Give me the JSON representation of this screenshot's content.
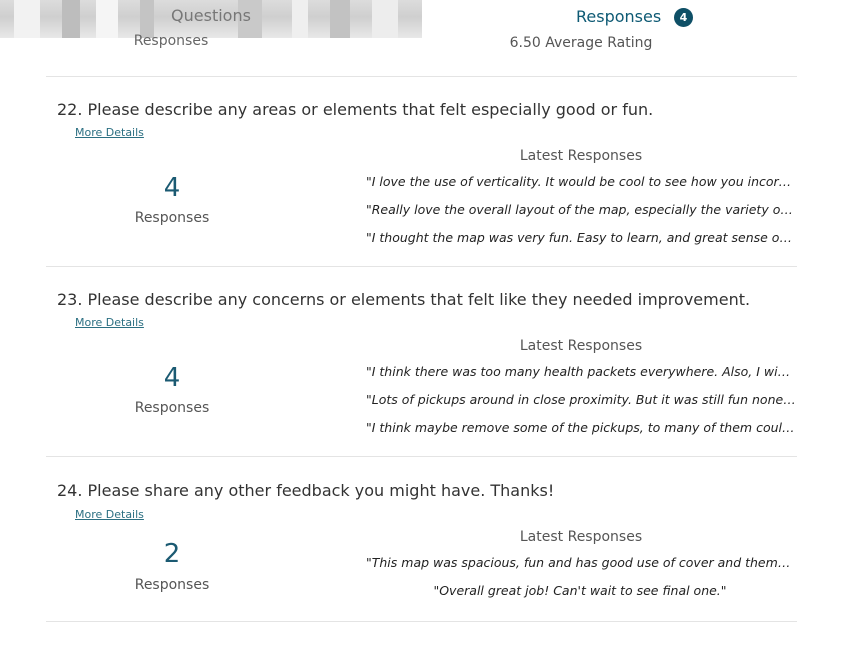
{
  "tabs": {
    "questions_label": "Questions",
    "questions_sub": "Responses",
    "responses_label": "Responses",
    "responses_badge": "4"
  },
  "previous": {
    "average_rating": "6.50 Average Rating"
  },
  "questions": [
    {
      "title": "22.  Please describe any areas or elements that felt especially good or fun.",
      "more_details": "More Details",
      "count": "4",
      "count_label": "Responses",
      "latest_title": "Latest Responses",
      "responses": [
        "\"I love the use of verticality. It would be cool to see how you incorporate more of it in your final map.\"",
        "\"Really love the overall layout of the map, especially the variety of the routes you can take.\"",
        "\"I thought the map was very fun. Easy to learn, and great sense of space throughout.\""
      ]
    },
    {
      "title": "23.  Please describe any concerns or elements that felt like they needed improvement.",
      "more_details": "More Details",
      "count": "4",
      "count_label": "Responses",
      "latest_title": "Latest Responses",
      "responses": [
        "\"I think there was too many health packets everywhere. Also, I wished there were more cover.\"",
        "\"Lots of pickups around in close proximity. But it was still fun nonetheless.\"",
        "\"I think maybe remove some of the pickups, to many of them could lead to camping.\""
      ]
    },
    {
      "title": "24.  Please share any other feedback you might have. Thanks!",
      "more_details": "More Details",
      "count": "2",
      "count_label": "Responses",
      "latest_title": "Latest Responses",
      "responses": [
        "\"This map was spacious, fun and has good use of cover and theme. I really enjoyed playing it.\"",
        "\"Overall great job! Can't wait to see final one.\""
      ]
    }
  ]
}
